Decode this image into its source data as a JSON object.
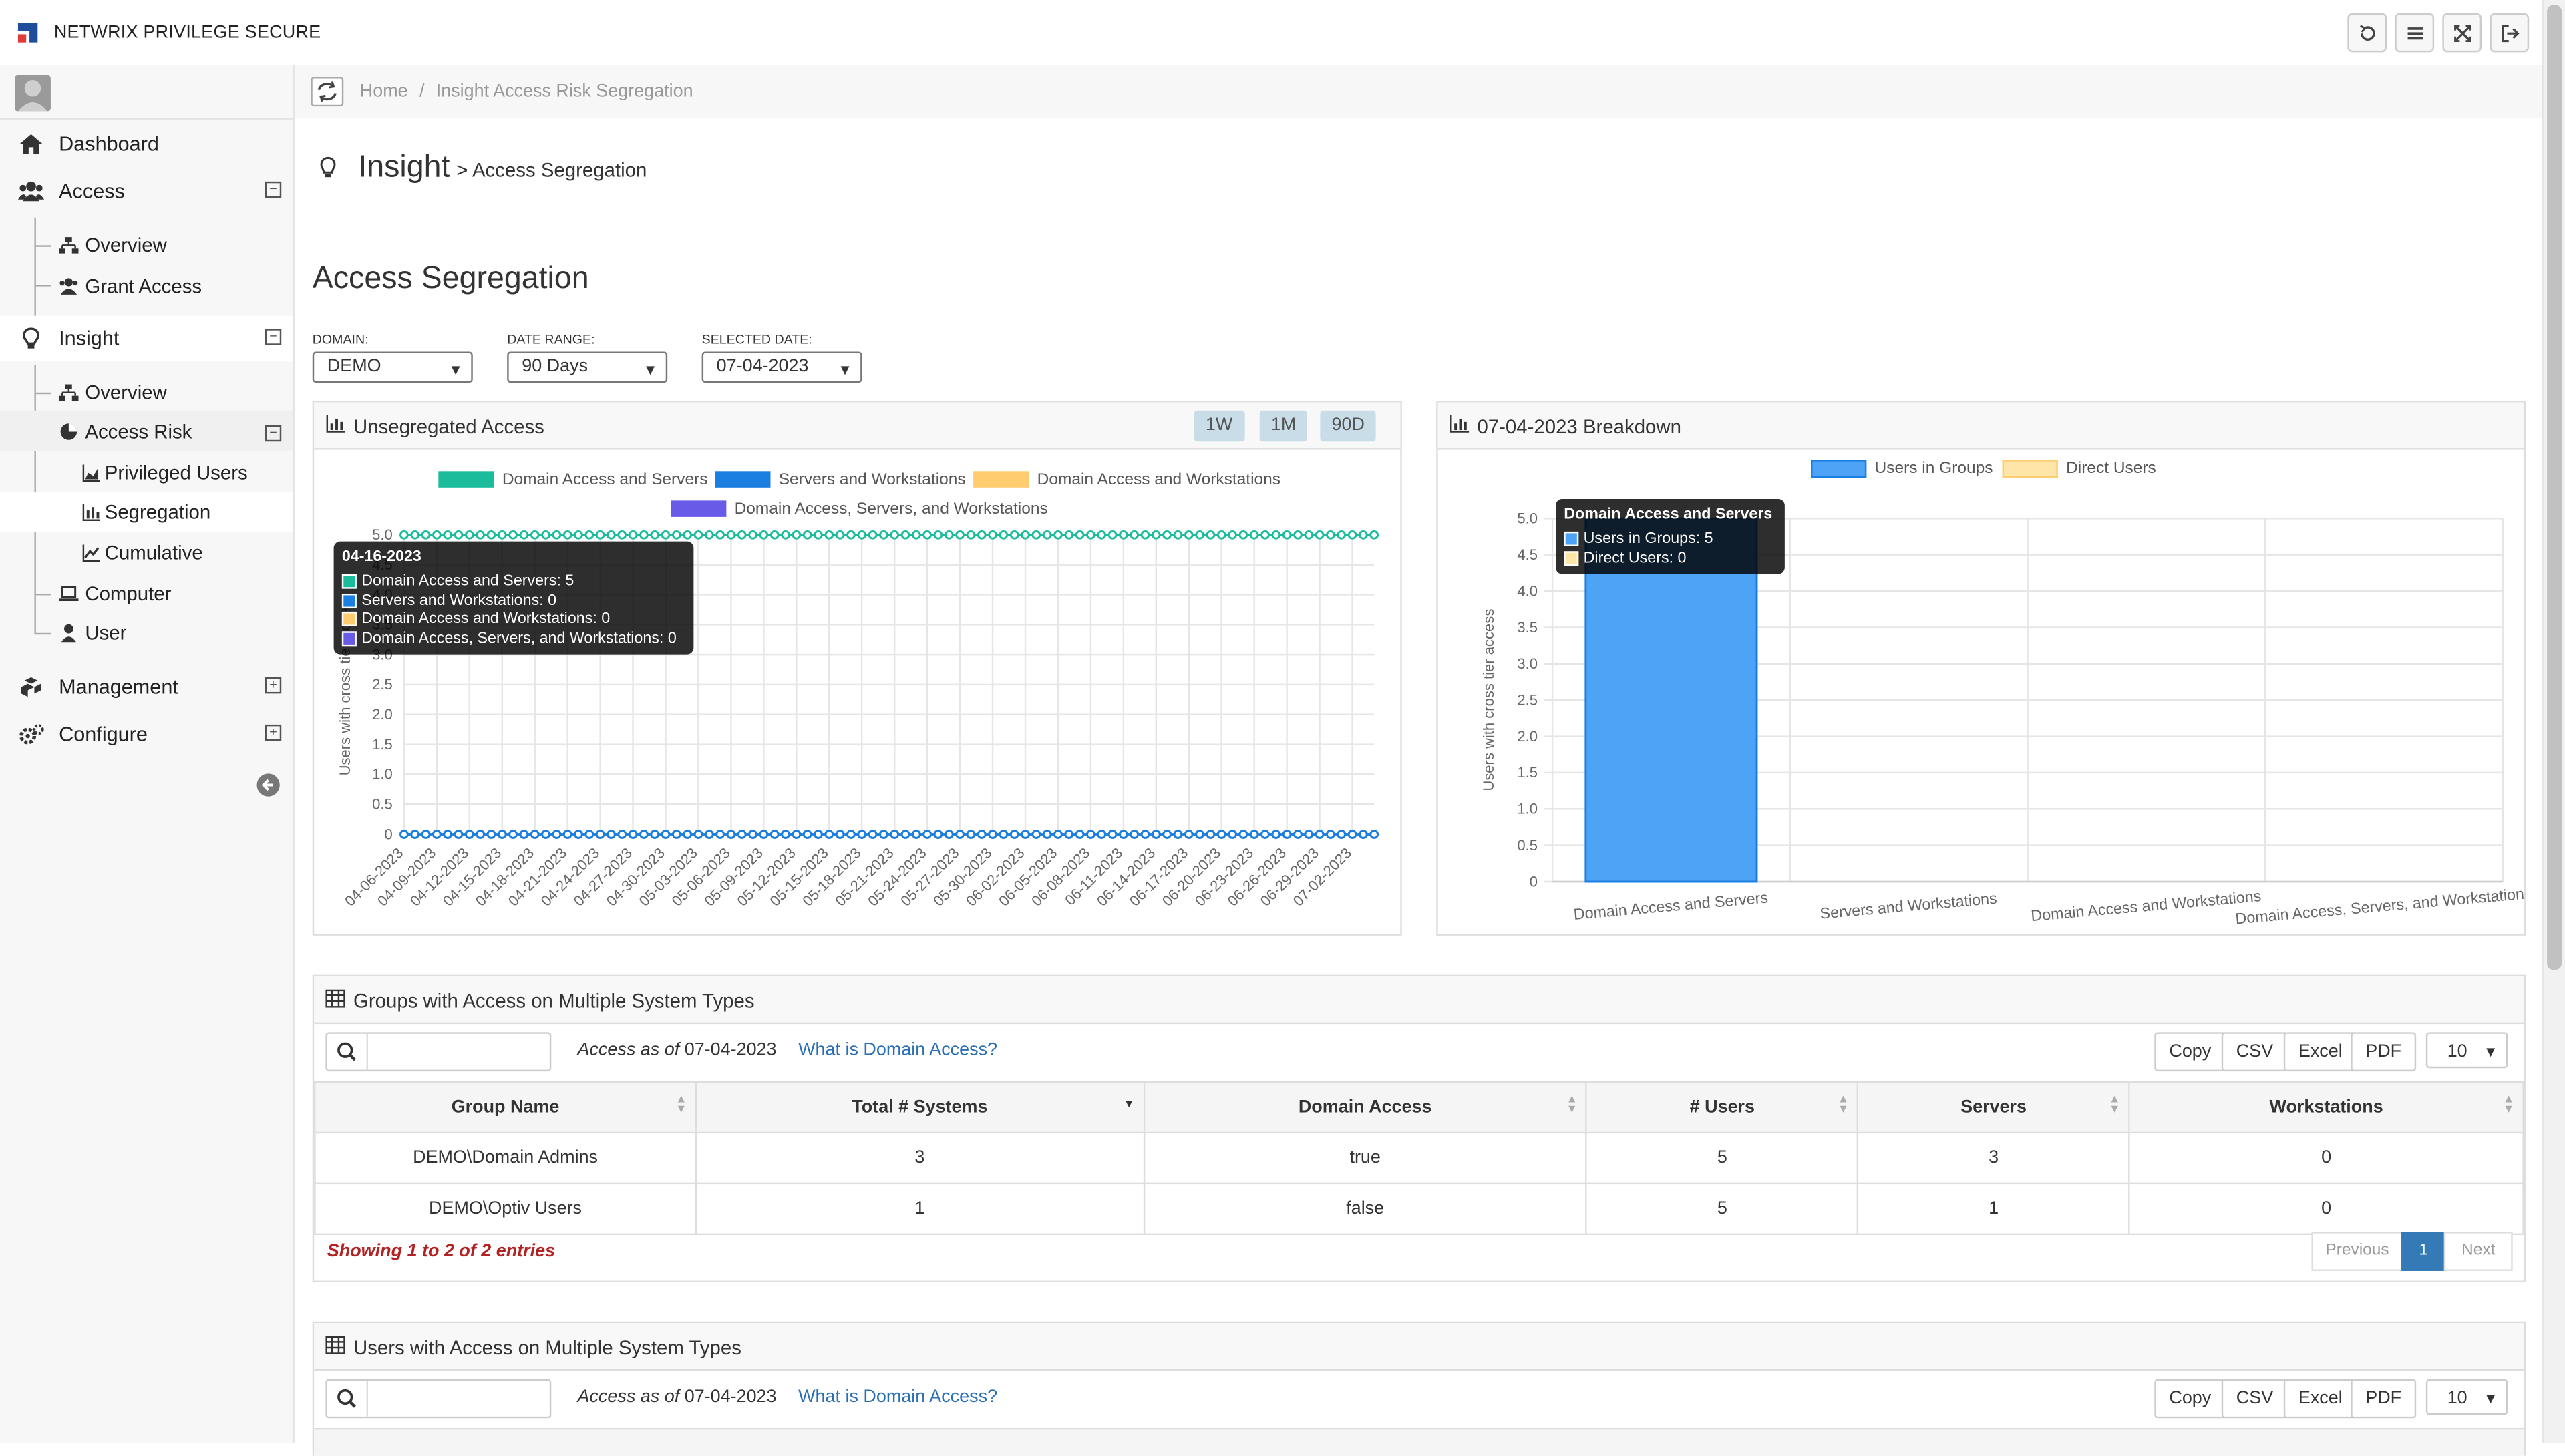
{
  "app": {
    "title": "NETWRIX PRIVILEGE SECURE"
  },
  "colors": {
    "accent": "#337ab7",
    "teal": "#1abc9c",
    "blue": "#1a7fe0",
    "yellow": "#ffcd70",
    "purple": "#6a5ae8",
    "danger": "#b22222"
  },
  "topbar": {
    "icons": [
      "refresh-icon",
      "menu-icon",
      "fullscreen-icon",
      "logout-icon"
    ]
  },
  "sidebar": {
    "items": {
      "dashboard": "Dashboard",
      "access": "Access",
      "access_overview": "Overview",
      "grant_access": "Grant Access",
      "insight": "Insight",
      "insight_overview": "Overview",
      "access_risk": "Access Risk",
      "privileged_users": "Privileged Users",
      "segregation": "Segregation",
      "cumulative": "Cumulative",
      "computer": "Computer",
      "user": "User",
      "management": "Management",
      "configure": "Configure"
    }
  },
  "breadcrumb": {
    "home": "Home",
    "sep": "/",
    "current": "Insight Access Risk Segregation"
  },
  "page": {
    "title": "Insight",
    "subtitle": "> Access Segregation",
    "section": "Access Segregation"
  },
  "filters": {
    "domain": {
      "label": "DOMAIN:",
      "value": "DEMO"
    },
    "range": {
      "label": "DATE RANGE:",
      "value": "90 Days"
    },
    "date": {
      "label": "SELECTED DATE:",
      "value": "07-04-2023"
    }
  },
  "panel_left": {
    "title": "Unsegregated Access",
    "buttons": [
      "1W",
      "1M",
      "90D"
    ]
  },
  "panel_right": {
    "title": "07-04-2023 Breakdown"
  },
  "chart_data": [
    {
      "type": "line",
      "ylabel": "Users with cross tier access",
      "ylim": [
        0,
        5
      ],
      "yticks": [
        "5.0",
        "4.5",
        "4.0",
        "3.5",
        "3.0",
        "2.5",
        "2.0",
        "1.5",
        "1.0",
        "0.5",
        "0"
      ],
      "xticks": [
        "04-06-2023",
        "04-09-2023",
        "04-12-2023",
        "04-15-2023",
        "04-18-2023",
        "04-21-2023",
        "04-24-2023",
        "04-27-2023",
        "04-30-2023",
        "05-03-2023",
        "05-06-2023",
        "05-09-2023",
        "05-12-2023",
        "05-15-2023",
        "05-18-2023",
        "05-21-2023",
        "05-24-2023",
        "05-27-2023",
        "05-30-2023",
        "06-02-2023",
        "06-05-2023",
        "06-08-2023",
        "06-11-2023",
        "06-14-2023",
        "06-17-2023",
        "06-20-2023",
        "06-23-2023",
        "06-26-2023",
        "06-29-2023",
        "07-02-2023"
      ],
      "point_count": 90,
      "series": [
        {
          "name": "Domain Access and Servers",
          "color": "#1abc9c",
          "value": 5
        },
        {
          "name": "Servers and Workstations",
          "color": "#1a7fe0",
          "value": 0
        },
        {
          "name": "Domain Access and Workstations",
          "color": "#ffcd70",
          "value": 0
        },
        {
          "name": "Domain Access, Servers, and Workstations",
          "color": "#6a5ae8",
          "value": 0
        }
      ],
      "tooltip": {
        "title": "04-16-2023",
        "rows": [
          "Domain Access and Servers: 5",
          "Servers and Workstations: 0",
          "Domain Access and Workstations: 0",
          "Domain Access, Servers, and Workstations: 0"
        ]
      }
    },
    {
      "type": "bar",
      "ylabel": "Users with cross tier access",
      "ylim": [
        0,
        5
      ],
      "yticks": [
        "5.0",
        "4.5",
        "4.0",
        "3.5",
        "3.0",
        "2.5",
        "2.0",
        "1.5",
        "1.0",
        "0.5",
        "0"
      ],
      "categories": [
        "Domain Access and Servers",
        "Servers and Workstations",
        "Domain Access and Workstations",
        "Domain Access, Servers, and Workstations"
      ],
      "series": [
        {
          "name": "Users in Groups",
          "color": "#4da3f5",
          "values": [
            5,
            0,
            0,
            0
          ]
        },
        {
          "name": "Direct Users",
          "color": "#ffe5a8",
          "values": [
            0,
            0,
            0,
            0
          ]
        }
      ],
      "tooltip": {
        "title": "Domain Access and Servers",
        "rows": [
          "Users in Groups: 5",
          "Direct Users: 0"
        ]
      }
    }
  ],
  "groups_table": {
    "title": "Groups with Access on Multiple System Types",
    "asof_label": "Access as of",
    "asof_date": "07-04-2023",
    "help_link": "What is Domain Access?",
    "buttons": [
      "Copy",
      "CSV",
      "Excel",
      "PDF"
    ],
    "page_size": "10",
    "columns": [
      "Group Name",
      "Total # Systems",
      "Domain Access",
      "# Users",
      "Servers",
      "Workstations"
    ],
    "rows": [
      [
        "DEMO\\Domain Admins",
        "3",
        "true",
        "5",
        "3",
        "0"
      ],
      [
        "DEMO\\Optiv Users",
        "1",
        "false",
        "5",
        "1",
        "0"
      ]
    ],
    "showing": "Showing 1 to 2 of 2 entries",
    "pager": {
      "prev": "Previous",
      "page": "1",
      "next": "Next"
    }
  },
  "users_table": {
    "title": "Users with Access on Multiple System Types",
    "asof_label": "Access as of",
    "asof_date": "07-04-2023",
    "help_link": "What is Domain Access?",
    "buttons": [
      "Copy",
      "CSV",
      "Excel",
      "PDF"
    ],
    "page_size": "10"
  }
}
